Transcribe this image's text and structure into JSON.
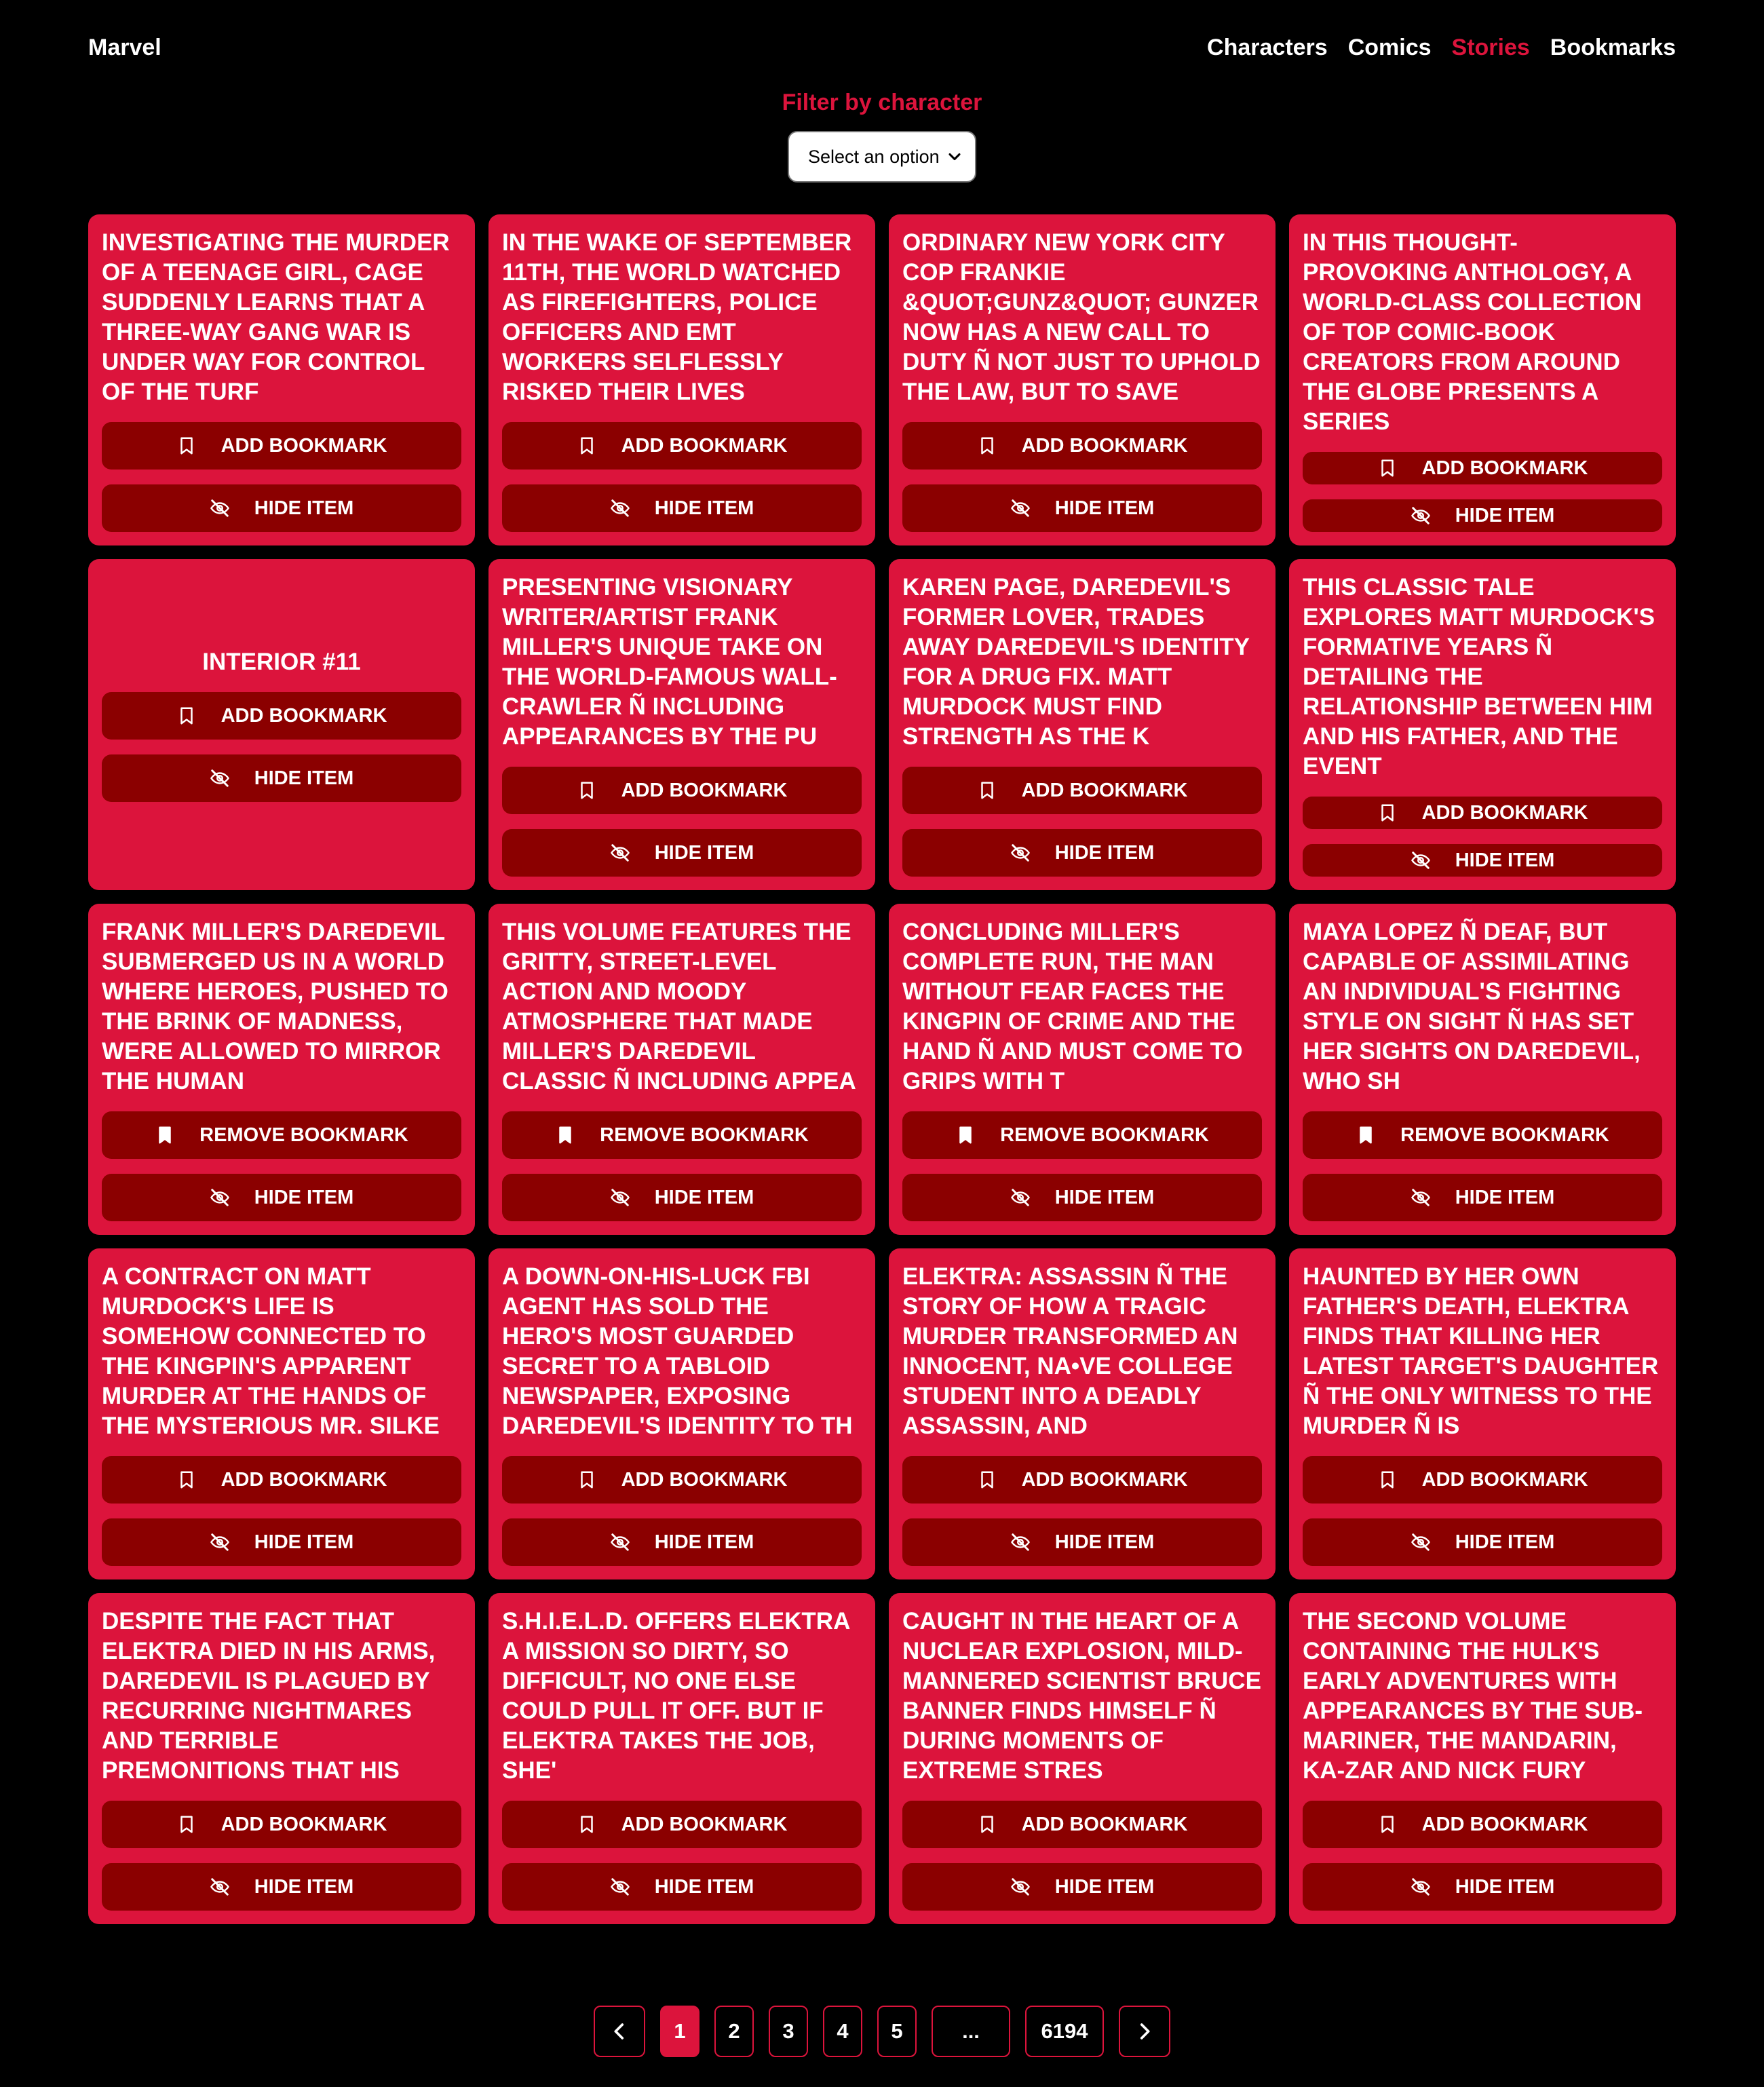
{
  "brand": "Marvel",
  "nav": [
    {
      "label": "Characters",
      "active": false
    },
    {
      "label": "Comics",
      "active": false
    },
    {
      "label": "Stories",
      "active": true
    },
    {
      "label": "Bookmarks",
      "active": false
    }
  ],
  "filter": {
    "title": "Filter by character",
    "select_placeholder": "Select an option"
  },
  "cards": [
    {
      "text": "Investigating the murder of a teenage girl, Cage suddenly learns that a three-way gang war is under way for control of the turf",
      "bookmark": "ADD BOOKMARK",
      "bookmarked": false,
      "hide": "HIDE ITEM"
    },
    {
      "text": "In the wake of September 11th, the world watched as firefighters, police officers and EMT workers selflessly risked their lives",
      "bookmark": "ADD BOOKMARK",
      "bookmarked": false,
      "hide": "HIDE ITEM"
    },
    {
      "text": "Ordinary New York City cop Frankie &QUOT;GUNZ&QUOT; Gunzer now has a new call to duty Ñ not just to uphold the law, but to save",
      "bookmark": "ADD BOOKMARK",
      "bookmarked": false,
      "hide": "HIDE ITEM"
    },
    {
      "text": "In this thought-provoking anthology, a world-class collection of top comic-book creators from around the globe presents a series",
      "bookmark": "ADD BOOKMARK",
      "bookmarked": false,
      "hide": "HIDE ITEM"
    },
    {
      "text": "INTERIOR #11",
      "bookmark": "ADD BOOKMARK",
      "bookmarked": false,
      "hide": "HIDE ITEM",
      "centered": true
    },
    {
      "text": "Presenting visionary writer/artist Frank Miller's unique take on the world-famous wall-crawler Ñ including appearances by the Pu",
      "bookmark": "ADD BOOKMARK",
      "bookmarked": false,
      "hide": "HIDE ITEM"
    },
    {
      "text": "Karen Page, Daredevil's former lover, trades away Daredevil's identity for a drug fix. Matt Murdock must find strength as the K",
      "bookmark": "ADD BOOKMARK",
      "bookmarked": false,
      "hide": "HIDE ITEM"
    },
    {
      "text": "This classic tale explores Matt Murdock's formative years Ñ detailing the relationship between him and his father, and the event",
      "bookmark": "ADD BOOKMARK",
      "bookmarked": false,
      "hide": "HIDE ITEM"
    },
    {
      "text": "Frank Miller's Daredevil submerged us in a world where heroes, pushed to the brink of madness, were allowed to mirror the human",
      "bookmark": "REMOVE BOOKMARK",
      "bookmarked": true,
      "hide": "HIDE ITEM"
    },
    {
      "text": "This volume features the gritty, street-level action and moody atmosphere that made Miller's Daredevil classic Ñ including appea",
      "bookmark": "REMOVE BOOKMARK",
      "bookmarked": true,
      "hide": "HIDE ITEM"
    },
    {
      "text": "Concluding Miller's complete run, the Man Without Fear faces the Kingpin of Crime and the Hand Ñ and must come to grips with t",
      "bookmark": "REMOVE BOOKMARK",
      "bookmarked": true,
      "hide": "HIDE ITEM"
    },
    {
      "text": "Maya Lopez Ñ deaf, but capable of assimilating an individual's fighting style on sight Ñ has set her sights on Daredevil, who sh",
      "bookmark": "REMOVE BOOKMARK",
      "bookmarked": true,
      "hide": "HIDE ITEM"
    },
    {
      "text": "A contract on Matt Murdock's life is somehow connected to the Kingpin's apparent murder at the hands of the mysterious Mr. Silke",
      "bookmark": "ADD BOOKMARK",
      "bookmarked": false,
      "hide": "HIDE ITEM"
    },
    {
      "text": "A down-on-his-luck FBI agent has sold the hero's most guarded secret to a tabloid newspaper, exposing Daredevil's identity to th",
      "bookmark": "ADD BOOKMARK",
      "bookmarked": false,
      "hide": "HIDE ITEM"
    },
    {
      "text": "Elektra: Assassin Ñ the story of how a tragic murder transformed an innocent, na•ve college student into a deadly assassin, and",
      "bookmark": "ADD BOOKMARK",
      "bookmarked": false,
      "hide": "HIDE ITEM"
    },
    {
      "text": "Haunted by her own father's death, Elektra finds that killing her latest target's daughter Ñ the only witness to the murder Ñ is",
      "bookmark": "ADD BOOKMARK",
      "bookmarked": false,
      "hide": "HIDE ITEM"
    },
    {
      "text": "Despite the fact that Elektra died in his arms, Daredevil is plagued by recurring nightmares and terrible premonitions that his",
      "bookmark": "ADD BOOKMARK",
      "bookmarked": false,
      "hide": "HIDE ITEM"
    },
    {
      "text": "S.H.I.E.L.D. offers Elektra a mission so dirty, so difficult, no one else could pull it off. But if Elektra takes the job, she'",
      "bookmark": "ADD BOOKMARK",
      "bookmarked": false,
      "hide": "HIDE ITEM"
    },
    {
      "text": "Caught in the heart of a nuclear explosion, mild-mannered scientist Bruce Banner finds himself Ñ during moments of extreme stres",
      "bookmark": "ADD BOOKMARK",
      "bookmarked": false,
      "hide": "HIDE ITEM"
    },
    {
      "text": "The second volume containing the Hulk's early adventures with appearances by the Sub-Mariner, the Mandarin, Ka-Zar and Nick Fury",
      "bookmark": "ADD BOOKMARK",
      "bookmarked": false,
      "hide": "HIDE ITEM"
    }
  ],
  "pagination": {
    "prev_icon": "chevron-left-icon",
    "next_icon": "chevron-right-icon",
    "pages": [
      "1",
      "2",
      "3",
      "4",
      "5",
      "...",
      "6194"
    ],
    "current": "1"
  },
  "colors": {
    "accent": "#dc143c",
    "button": "#8b0000",
    "background": "#000000"
  }
}
